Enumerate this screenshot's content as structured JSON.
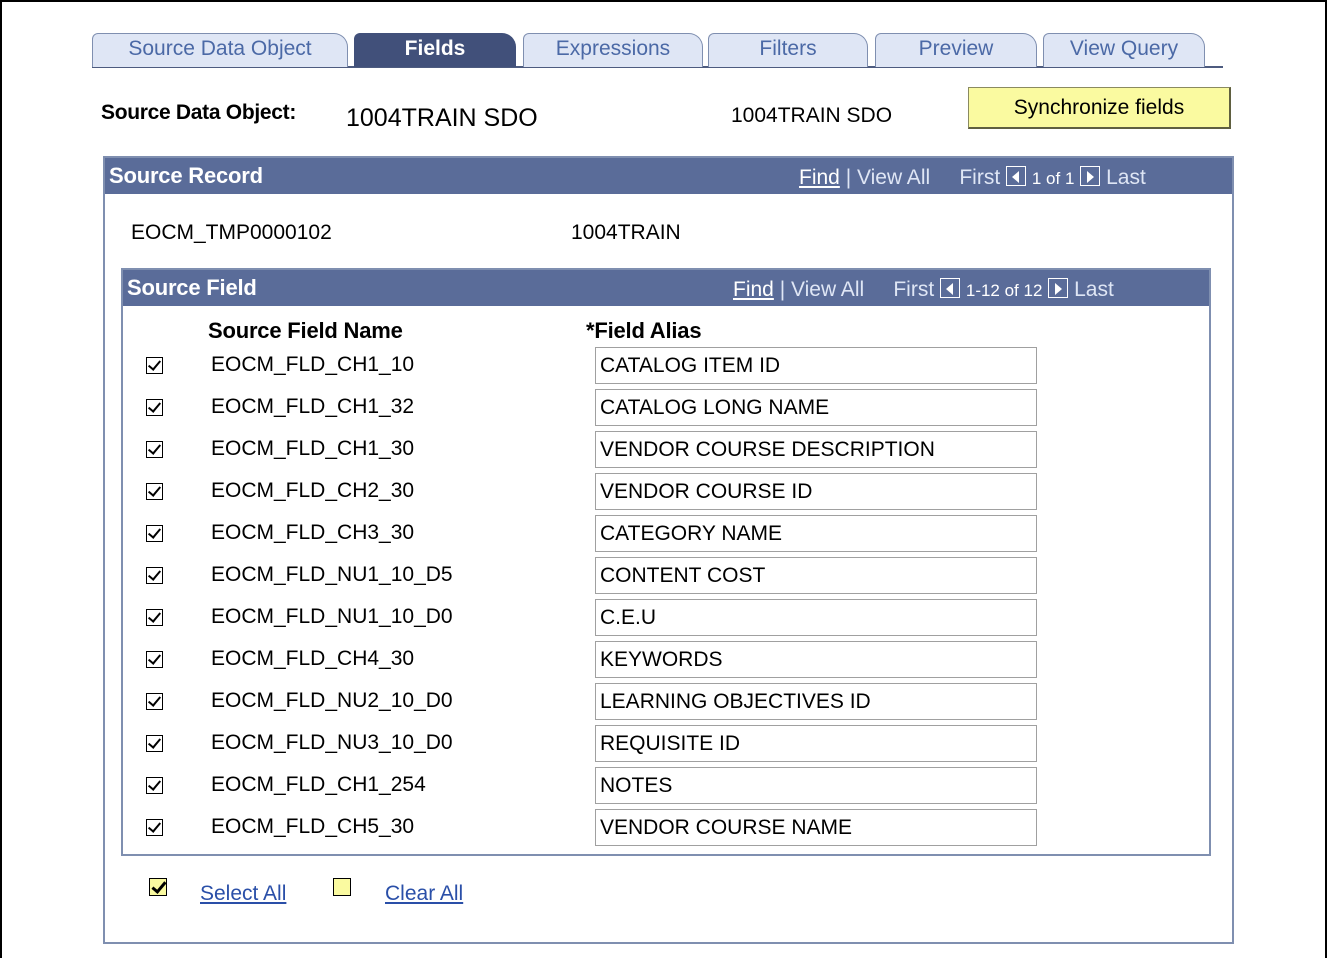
{
  "tabs": [
    {
      "label": "Source Data Object",
      "active": false
    },
    {
      "label": "Fields",
      "active": true
    },
    {
      "label": "Expressions",
      "active": false
    },
    {
      "label": "Filters",
      "active": false
    },
    {
      "label": "Preview",
      "active": false
    },
    {
      "label": "View Query",
      "active": false
    }
  ],
  "header": {
    "sdo_label": "Source Data Object:",
    "sdo_value": "1004TRAIN SDO",
    "sdo_description": "1004TRAIN SDO",
    "sync_button": "Synchronize fields"
  },
  "source_record": {
    "title": "Source Record",
    "find": "Find",
    "view_all": "| View All",
    "first": "First",
    "count": "1 of 1",
    "last": "Last",
    "record_id": "EOCM_TMP0000102",
    "record_desc": "1004TRAIN"
  },
  "source_field": {
    "title": "Source Field",
    "find": "Find",
    "view_all": "| View All",
    "first": "First",
    "count": "1-12 of 12",
    "last": "Last",
    "col_name": "Source Field Name",
    "col_alias": "*Field Alias",
    "rows": [
      {
        "name": "EOCM_FLD_CH1_10",
        "alias": "CATALOG ITEM ID",
        "checked": true
      },
      {
        "name": "EOCM_FLD_CH1_32",
        "alias": "CATALOG LONG NAME",
        "checked": true
      },
      {
        "name": "EOCM_FLD_CH1_30",
        "alias": "VENDOR COURSE DESCRIPTION",
        "checked": true
      },
      {
        "name": "EOCM_FLD_CH2_30",
        "alias": "VENDOR COURSE ID",
        "checked": true
      },
      {
        "name": "EOCM_FLD_CH3_30",
        "alias": "CATEGORY NAME",
        "checked": true
      },
      {
        "name": "EOCM_FLD_NU1_10_D5",
        "alias": "CONTENT COST",
        "checked": true
      },
      {
        "name": "EOCM_FLD_NU1_10_D0",
        "alias": "C.E.U",
        "checked": true
      },
      {
        "name": "EOCM_FLD_CH4_30",
        "alias": "KEYWORDS",
        "checked": true
      },
      {
        "name": "EOCM_FLD_NU2_10_D0",
        "alias": "LEARNING OBJECTIVES ID",
        "checked": true
      },
      {
        "name": "EOCM_FLD_NU3_10_D0",
        "alias": "REQUISITE ID",
        "checked": true
      },
      {
        "name": "EOCM_FLD_CH1_254",
        "alias": "NOTES",
        "checked": true
      },
      {
        "name": "EOCM_FLD_CH5_30",
        "alias": "VENDOR COURSE NAME",
        "checked": true
      }
    ]
  },
  "footer": {
    "select_all": "Select All",
    "clear_all": "Clear All"
  },
  "colors": {
    "tab_active": "#41507a",
    "grid_header": "#5a6c99",
    "button_bg": "#fafaa0",
    "link": "#2a4fa8"
  }
}
